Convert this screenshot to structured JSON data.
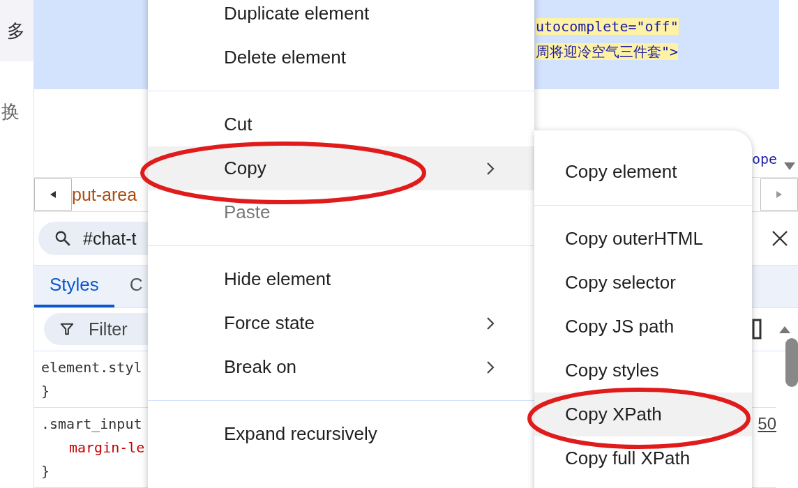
{
  "page": {
    "texts": [
      "多",
      "换"
    ]
  },
  "elements_panel": {
    "code_lines": [
      "utocomplete=\"off\"",
      "周将迎冷空气三件套\">"
    ],
    "fragment": "ope"
  },
  "breadcrumb": {
    "text": "put-area"
  },
  "search": {
    "value": "#chat-t"
  },
  "tabs": [
    {
      "label": "Styles",
      "selected": true
    },
    {
      "label": "C",
      "selected": false
    }
  ],
  "filter": {
    "placeholder": "Filter"
  },
  "style_rules": [
    {
      "selector": "element.styl",
      "close": "}"
    },
    {
      "selector": ".smart_input",
      "declarations": [
        "margin-le"
      ],
      "close": "}",
      "source": "50"
    }
  ],
  "context_menu": {
    "items": [
      {
        "kind": "item",
        "label": "Duplicate element",
        "disabled": false,
        "submenu": false,
        "selected": false
      },
      {
        "kind": "item",
        "label": "Delete element",
        "disabled": false,
        "submenu": false,
        "selected": false
      },
      {
        "kind": "separator"
      },
      {
        "kind": "item",
        "label": "Cut",
        "disabled": false,
        "submenu": false,
        "selected": false
      },
      {
        "kind": "item",
        "label": "Copy",
        "disabled": false,
        "submenu": true,
        "selected": true
      },
      {
        "kind": "item",
        "label": "Paste",
        "disabled": true,
        "submenu": false,
        "selected": false
      },
      {
        "kind": "separator"
      },
      {
        "kind": "item",
        "label": "Hide element",
        "disabled": false,
        "submenu": false,
        "selected": false
      },
      {
        "kind": "item",
        "label": "Force state",
        "disabled": false,
        "submenu": true,
        "selected": false
      },
      {
        "kind": "item",
        "label": "Break on",
        "disabled": false,
        "submenu": true,
        "selected": false
      },
      {
        "kind": "separator"
      },
      {
        "kind": "item",
        "label": "Expand recursively",
        "disabled": false,
        "submenu": false,
        "selected": false
      }
    ]
  },
  "copy_submenu": {
    "items": [
      {
        "kind": "item",
        "label": "Copy element",
        "selected": false
      },
      {
        "kind": "separator"
      },
      {
        "kind": "item",
        "label": "Copy outerHTML",
        "selected": false
      },
      {
        "kind": "item",
        "label": "Copy selector",
        "selected": false
      },
      {
        "kind": "item",
        "label": "Copy JS path",
        "selected": false
      },
      {
        "kind": "item",
        "label": "Copy styles",
        "selected": false
      },
      {
        "kind": "item",
        "label": "Copy XPath",
        "selected": true
      },
      {
        "kind": "item",
        "label": "Copy full XPath",
        "selected": false
      }
    ]
  }
}
